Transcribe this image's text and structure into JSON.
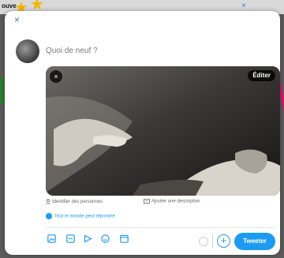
{
  "background": {
    "top_word": "ouve",
    "top_x": "×"
  },
  "composer": {
    "close_label": "×",
    "placeholder": "Quoi de neuf ?",
    "media": {
      "remove_label": "×",
      "edit_label": "Éditer"
    },
    "tag_people_label": "Identifier des personnes",
    "add_description_label": "Ajouter une description",
    "reply_setting_label": "Tout le monde peut répondre",
    "add_tweet_label": "+",
    "tweet_button_label": "Tweeter"
  },
  "toolbar_icons": [
    "image-icon",
    "gif-icon",
    "poll-icon",
    "emoji-icon",
    "schedule-icon"
  ],
  "colors": {
    "accent": "#1d9bf0",
    "modal_bg": "#ffffff",
    "overlay": "#5b5b5b"
  }
}
